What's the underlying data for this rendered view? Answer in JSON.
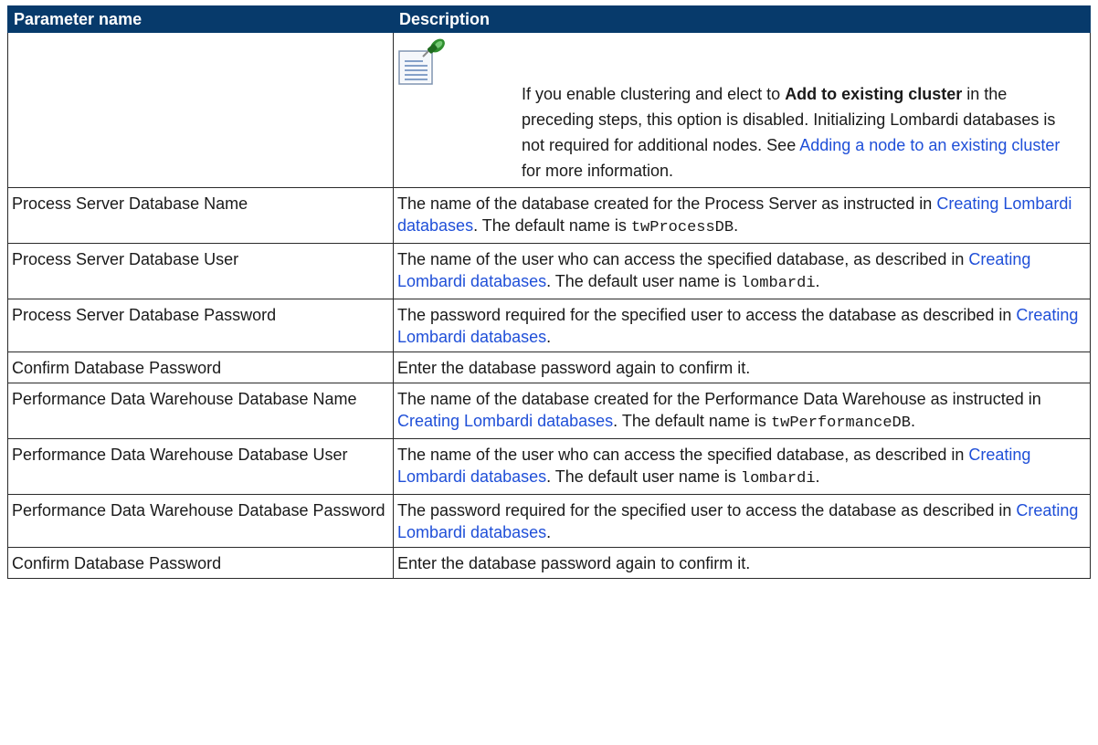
{
  "table": {
    "headers": {
      "name": "Parameter name",
      "description": "Description"
    },
    "note": {
      "icon": "note-pin-icon",
      "pre": "If you enable clustering and elect to ",
      "bold": "Add to existing cluster",
      "mid": " in the preceding steps, this option is disabled. Initializing Lombardi databases is not required for additional nodes. See ",
      "link": "Adding a node to an existing cluster",
      "post": " for more information."
    },
    "rows": [
      {
        "name": "Process Server Database Name",
        "pre": "The name of the database created for the Process Server as instructed in ",
        "link": "Creating Lombardi databases",
        "mid": ". The default name is ",
        "code": "twProcessDB",
        "post": "."
      },
      {
        "name": "Process Server Database User",
        "pre": "The name of the user who can access the specified database, as described in ",
        "link": "Creating Lombardi databases",
        "mid": ". The default user name is ",
        "code": "lombardi",
        "post": "."
      },
      {
        "name": "Process Server Database Password",
        "pre": "The password required for the specified user to access the database as described in ",
        "link": "Creating Lombardi databases",
        "post": "."
      },
      {
        "name": "Confirm Database Password",
        "pre": "Enter the database password again to confirm it."
      },
      {
        "name": "Performance Data Warehouse Database Name",
        "pre": "The name of the database created for the Performance Data Warehouse as instructed in ",
        "link": "Creating Lombardi databases",
        "mid": ". The default name is ",
        "code": "twPerformanceDB",
        "post": "."
      },
      {
        "name": "Performance Data Warehouse Database User",
        "pre": "The name of the user who can access the specified database, as described in ",
        "link": "Creating Lombardi databases",
        "mid": ". The default user name is ",
        "code": "lombardi",
        "post": "."
      },
      {
        "name": "Performance Data Warehouse Database Password",
        "pre": "The password required for the specified user to access the database as described in ",
        "link": "Creating Lombardi databases",
        "post": "."
      },
      {
        "name": "Confirm Database Password",
        "pre": "Enter the database password again to confirm it."
      }
    ]
  }
}
